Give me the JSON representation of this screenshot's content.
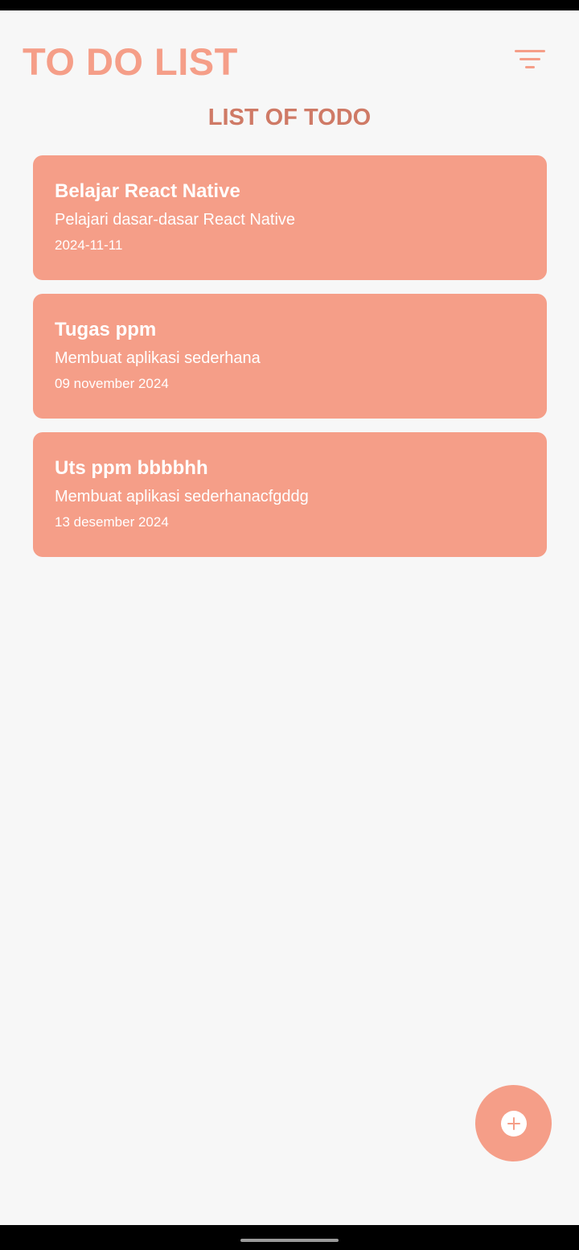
{
  "header": {
    "title": "TO DO LIST",
    "filter_icon": "filter-list-icon"
  },
  "section_title": "LIST OF TODO",
  "todos": [
    {
      "title": "Belajar React Native",
      "description": "Pelajari dasar-dasar React Native",
      "date": "2024-11-11"
    },
    {
      "title": "Tugas ppm",
      "description": "Membuat aplikasi sederhana",
      "date": "09 november 2024"
    },
    {
      "title": "Uts ppm bbbbhh",
      "description": "Membuat aplikasi sederhanacfgddg",
      "date": "13 desember 2024"
    }
  ],
  "fab": {
    "icon": "add-circle-icon"
  },
  "colors": {
    "accent": "#f59e88",
    "section_title": "#cf7a66",
    "background": "#f7f7f7",
    "card_text": "#ffffff"
  }
}
